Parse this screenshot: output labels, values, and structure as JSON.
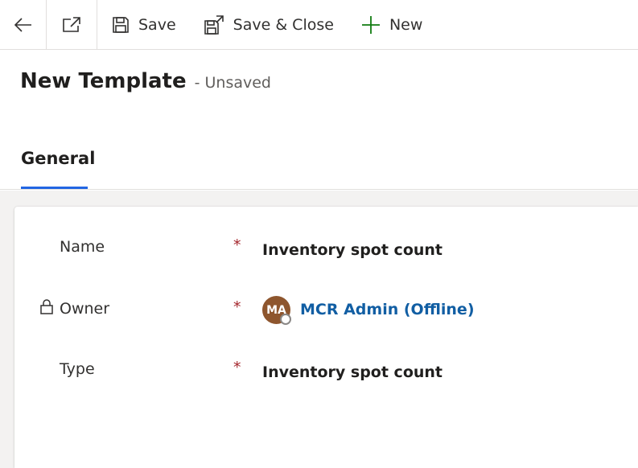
{
  "toolbar": {
    "back_icon": "arrow-left-icon",
    "popout_icon": "open-in-new-window-icon",
    "save_label": "Save",
    "save_close_label": "Save & Close",
    "new_label": "New",
    "new_icon_color": "#107c10"
  },
  "header": {
    "title": "New Template",
    "status": "- Unsaved"
  },
  "tabs": [
    {
      "label": "General",
      "active": true
    }
  ],
  "form": {
    "fields": [
      {
        "label": "Name",
        "required": "*",
        "value": "Inventory spot count"
      },
      {
        "label": "Owner",
        "required": "*",
        "avatar_initials": "MA",
        "value": "MCR Admin (Offline)",
        "locked": true
      },
      {
        "label": "Type",
        "required": "*",
        "value": "Inventory spot count"
      }
    ]
  },
  "colors": {
    "accent": "#2266e3",
    "required": "#a4262c",
    "link": "#115ea3",
    "avatar": "#8e562e"
  }
}
